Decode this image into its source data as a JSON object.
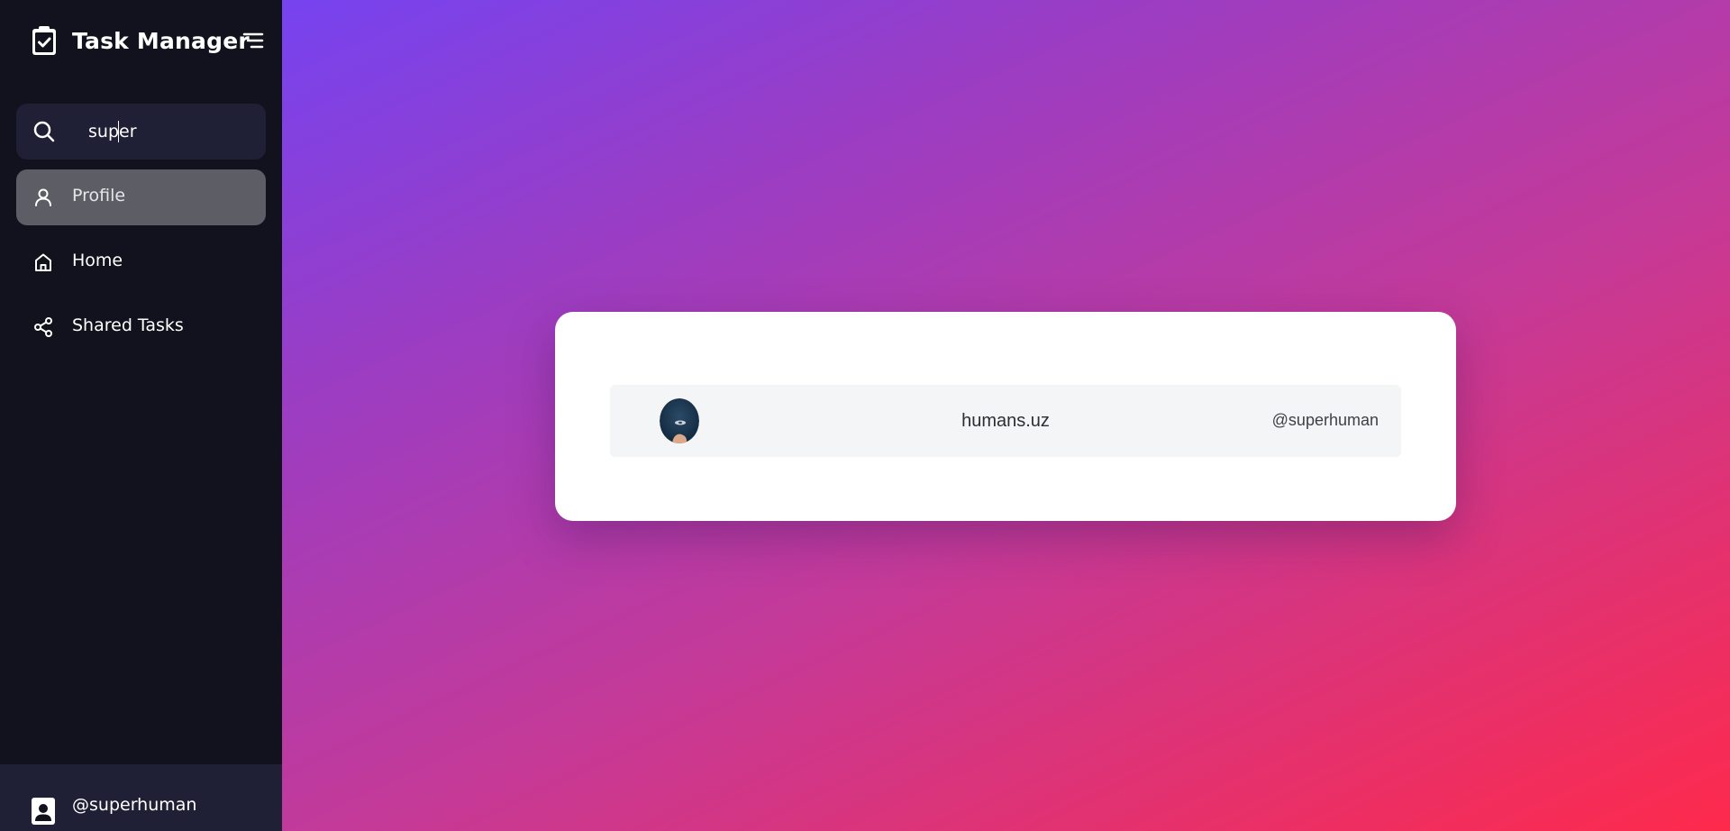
{
  "app": {
    "title": "Task Manager",
    "brand_icon": "clipboard-check-icon",
    "menu_icon": "menu-lines-icon"
  },
  "search": {
    "value": "super",
    "icon": "search-icon"
  },
  "sidebar": {
    "items": [
      {
        "label": "Profile",
        "icon": "user-icon",
        "active": true
      },
      {
        "label": "Home",
        "icon": "home-icon",
        "active": false
      },
      {
        "label": "Shared Tasks",
        "icon": "share-icon",
        "active": false
      }
    ]
  },
  "user": {
    "handle": "@superhuman",
    "icon": "contact-card-icon"
  },
  "results": [
    {
      "name": "humans.uz",
      "handle": "@superhuman",
      "avatar": "avatar-image"
    }
  ],
  "colors": {
    "sidebar_bg": "#12121e",
    "panel_bg": "#1f1f36",
    "active_item_bg": "#5d5d65",
    "gradient_start": "#6a45fe",
    "gradient_end": "#fe2a4c",
    "card_bg": "#ffffff",
    "row_bg": "#f4f5f6"
  }
}
